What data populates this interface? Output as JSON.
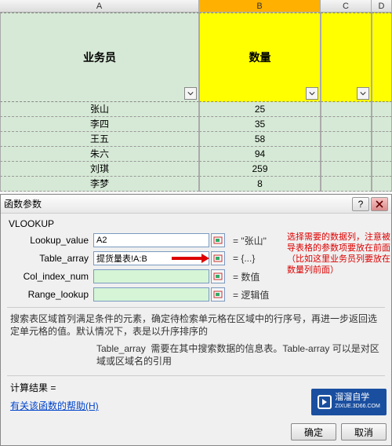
{
  "columns": {
    "A": "A",
    "B": "B",
    "C": "C",
    "D": "D"
  },
  "headers": {
    "A": "业务员",
    "B": "数量",
    "C": "",
    "D": ""
  },
  "rows": [
    {
      "a": "张山",
      "b": "25"
    },
    {
      "a": "李四",
      "b": "35"
    },
    {
      "a": "王五",
      "b": "58"
    },
    {
      "a": "朱六",
      "b": "94"
    },
    {
      "a": "刘琪",
      "b": "259"
    },
    {
      "a": "李梦",
      "b": "8"
    }
  ],
  "dialog": {
    "title": "函数参数",
    "funcname": "VLOOKUP",
    "params": {
      "lookup_value": {
        "label": "Lookup_value",
        "value": "A2",
        "result": "= \"张山\""
      },
      "table_array": {
        "label": "Table_array",
        "value": "提货量表!A:B",
        "result": "= {...}"
      },
      "col_index_num": {
        "label": "Col_index_num",
        "value": "",
        "result": "= 数值"
      },
      "range_lookup": {
        "label": "Range_lookup",
        "value": "",
        "result": "= 逻辑值"
      }
    },
    "annotation": "选择需要的数据列，注意被导表格的参数项要放在前面（比如这里业务员列要放在数量列前面）",
    "desc_main": "搜索表区域首列满足条件的元素，确定待检索单元格在区域中的行序号，再进一步返回选定单元格的值。默认情况下，表是以升序排序的",
    "desc_sub_label": "Table_array",
    "desc_sub_text": "需要在其中搜索数据的信息表。Table-array 可以是对区域或区域名的引用",
    "result_label": "计算结果 =",
    "help": "有关该函数的帮助(H)",
    "ok": "确定",
    "cancel": "取消"
  },
  "promo": {
    "line1": "溜溜自学",
    "line2": "ZIXUE.3D66.COM"
  }
}
